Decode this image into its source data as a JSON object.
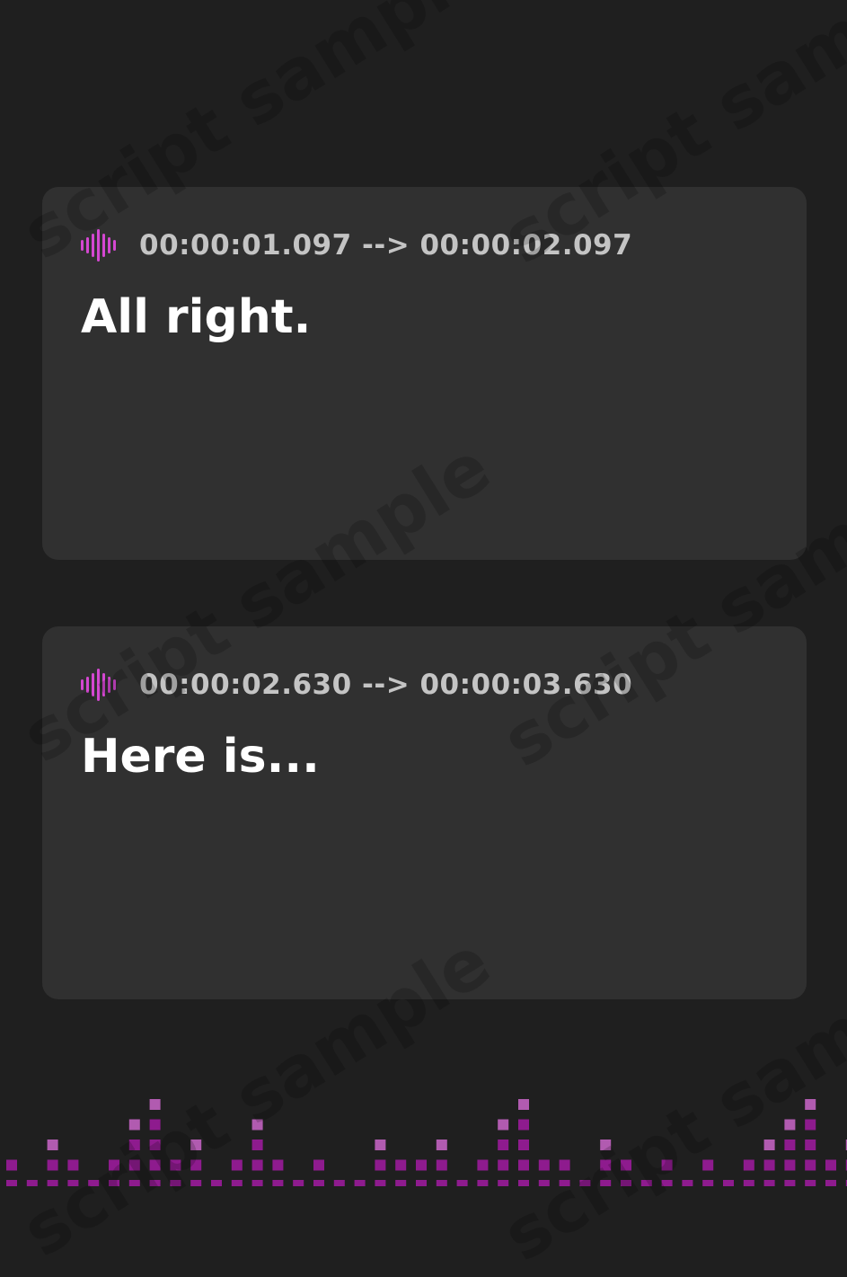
{
  "watermark": "script sample",
  "cues": [
    {
      "start": "00:00:01.097",
      "arrow": "-->",
      "end": "00:00:02.097",
      "timestamp": "00:00:01.097 --> 00:00:02.097",
      "text": "All right."
    },
    {
      "start": "00:00:02.630",
      "arrow": "-->",
      "end": "00:00:03.630",
      "timestamp": "00:00:02.630 --> 00:00:03.630",
      "text": "Here is..."
    }
  ],
  "icons": {
    "cue_icon": "audio-waveform-icon",
    "footer": "equalizer-bars-icon"
  },
  "colors": {
    "background": "#1f1f1f",
    "card": "#303030",
    "accent": "#d447d1",
    "timestamp": "#c4c4c4",
    "text": "#ffffff",
    "equalizer_dark": "#8e1b8e",
    "equalizer_light": "#b15bb0"
  }
}
